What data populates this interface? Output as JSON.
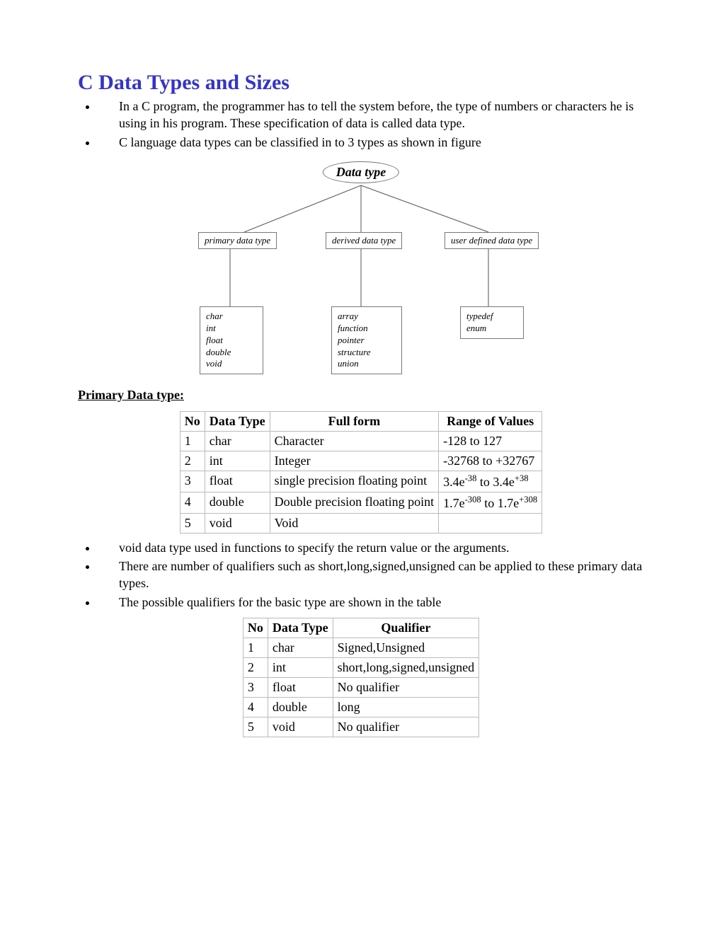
{
  "title": "C Data Types and Sizes",
  "intro_bullets": [
    "In a C program, the programmer has to tell the system before, the type of numbers or characters he is using in his program. These specification of data is called data type.",
    "C language data types can be classified in to 3 types as shown in figure"
  ],
  "diagram": {
    "root": "Data type",
    "mids": [
      "primary data type",
      "derived data type",
      "user defined data type"
    ],
    "leaves": [
      [
        "char",
        "int",
        "float",
        "double",
        "void"
      ],
      [
        "array",
        "function",
        "pointer",
        "structure",
        "union"
      ],
      [
        "typedef",
        "enum"
      ]
    ]
  },
  "section1_heading": "Primary Data type:",
  "table1": {
    "headers": [
      "No",
      "Data Type",
      "Full form",
      "Range of Values"
    ],
    "rows": [
      {
        "no": "1",
        "type": "char",
        "full": "Character",
        "range": "-128 to 127"
      },
      {
        "no": "2",
        "type": "int",
        "full": "Integer",
        "range": "-32768 to +32767"
      },
      {
        "no": "3",
        "type": "float",
        "full": "single precision floating point",
        "range_html": "3.4e<sup>-38</sup> to 3.4e<sup>+38</sup>"
      },
      {
        "no": "4",
        "type": "double",
        "full": "Double precision floating point",
        "range_html": "1.7e<sup>-308</sup> to 1.7e<sup>+308</sup>"
      },
      {
        "no": "5",
        "type": "void",
        "full": "Void",
        "range": ""
      }
    ]
  },
  "mid_bullets": [
    "void data type used in functions to specify the return value or the arguments.",
    "There are number of qualifiers such as short,long,signed,unsigned can be applied to these primary data types.",
    "The possible qualifiers for the basic type are shown in the table"
  ],
  "table2": {
    "headers": [
      "No",
      "Data Type",
      "Qualifier"
    ],
    "rows": [
      {
        "no": "1",
        "type": "char",
        "qual": "Signed,Unsigned"
      },
      {
        "no": "2",
        "type": "int",
        "qual": "short,long,signed,unsigned"
      },
      {
        "no": "3",
        "type": "float",
        "qual": "No qualifier"
      },
      {
        "no": "4",
        "type": "double",
        "qual": "long"
      },
      {
        "no": "5",
        "type": "void",
        "qual": "No qualifier"
      }
    ]
  }
}
